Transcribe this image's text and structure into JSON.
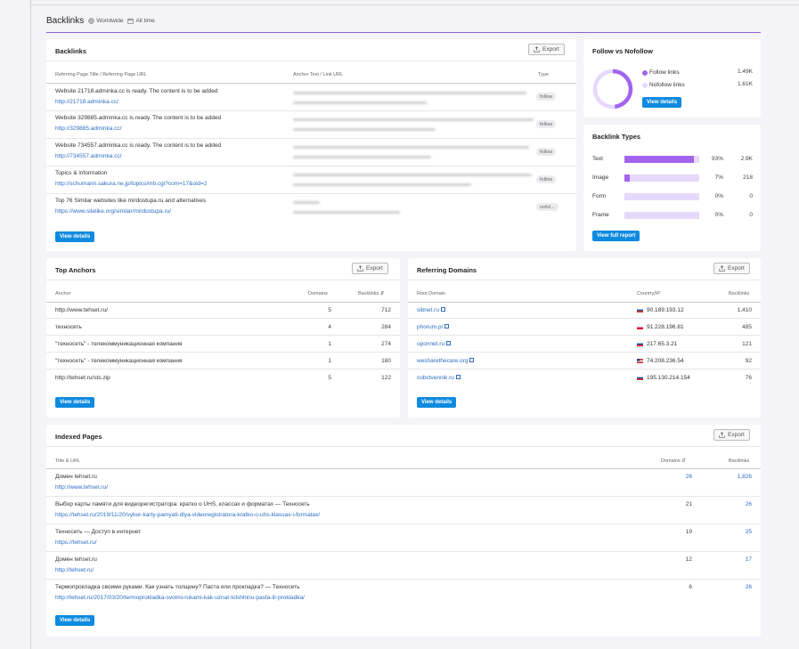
{
  "header": {
    "title": "Backlinks",
    "region": "Worldwide",
    "period": "All time"
  },
  "backlinks": {
    "title": "Backlinks",
    "export_label": "Export",
    "col_ref": "Referring Page Title / Referring Page URL",
    "col_anchor": "Anchor Text / Link URL",
    "col_type": "Type",
    "rows": [
      {
        "title": "Website 21718.adminka.cc is ready. The content is to be added",
        "url": "http://21718.adminka.cc/",
        "type": "follow"
      },
      {
        "title": "Website 329885.adminka.cc is ready. The content is to be added",
        "url": "http://329885.adminka.cc/",
        "type": "follow"
      },
      {
        "title": "Website 734557.adminka.cc is ready. The content is to be added",
        "url": "http://734557.adminka.cc/",
        "type": "follow"
      },
      {
        "title": "Topics & information",
        "url": "http://schumann.sakura.ne.jp/topics/mb.cgi?com=17&oid=2",
        "type": "follow"
      },
      {
        "title": "Top 76 Similar websites like mirdostupa.ru and alternatives",
        "url": "https://www.sitelike.org/similar/mirdostupa.ru/",
        "type": "nofol..."
      }
    ],
    "view_label": "View details"
  },
  "follow": {
    "title": "Follow vs Nofollow",
    "follow_label": "Follow links",
    "follow_value": "1.49K",
    "nofollow_label": "Nofollow links",
    "nofollow_value": "1.61K",
    "view_label": "View details",
    "colors": {
      "follow": "#a264ee",
      "nofollow": "#e6d9fb"
    }
  },
  "types": {
    "title": "Backlink Types",
    "rows": [
      {
        "label": "Text",
        "pct": "93%",
        "count": "2.9K",
        "fill": 0.93
      },
      {
        "label": "Image",
        "pct": "7%",
        "count": "218",
        "fill": 0.07
      },
      {
        "label": "Form",
        "pct": "0%",
        "count": "0",
        "fill": 0
      },
      {
        "label": "Frame",
        "pct": "0%",
        "count": "0",
        "fill": 0
      }
    ],
    "report_label": "View full report"
  },
  "anchors": {
    "title": "Top Anchors",
    "export_label": "Export",
    "col_anchor": "Anchor",
    "col_domains": "Domains",
    "col_backlinks": "Backlinks",
    "rows": [
      {
        "anchor": "http://www.tehset.ru/",
        "domains": "5",
        "backlinks": "712"
      },
      {
        "anchor": "техносеть",
        "domains": "4",
        "backlinks": "284"
      },
      {
        "anchor": "\"техносеть\" - телекоммуникационная компания",
        "domains": "1",
        "backlinks": "274"
      },
      {
        "anchor": "\"техносеть\" - телекоммуникационная компания",
        "domains": "1",
        "backlinks": "180"
      },
      {
        "anchor": "http://tehset.ru/sts.zip",
        "domains": "5",
        "backlinks": "122"
      }
    ],
    "view_label": "View details"
  },
  "domains": {
    "title": "Referring Domains",
    "export_label": "Export",
    "col_root": "Root Domain",
    "col_country": "Country/IP",
    "col_backlinks": "Backlinks",
    "rows": [
      {
        "domain": "sibnet.ru",
        "flag": "ru",
        "ip": "90.189.193.12",
        "backlinks": "1,410"
      },
      {
        "domain": "phorum.pl",
        "flag": "pl",
        "ip": "91.228.196.81",
        "backlinks": "485"
      },
      {
        "domain": "oponnet.ru",
        "flag": "ru",
        "ip": "217.65.3.21",
        "backlinks": "121"
      },
      {
        "domain": "wesharethecare.org",
        "flag": "us",
        "ip": "74.208.236.54",
        "backlinks": "92"
      },
      {
        "domain": "cobctvennik.ru",
        "flag": "ru",
        "ip": "195.130.214.154",
        "backlinks": "76"
      }
    ],
    "view_label": "View details"
  },
  "indexed": {
    "title": "Indexed Pages",
    "export_label": "Export",
    "col_title": "Title & URL",
    "col_domains": "Domains",
    "col_backlinks": "Backlinks",
    "rows": [
      {
        "title": "Домен tehset.ru",
        "url": "http://www.tehset.ru/",
        "domains": "26",
        "backlinks": "1,826"
      },
      {
        "title": "Выбор карты памяти для видеорегистратора: кратко о UHS, классах и форматах — Техносеть",
        "url": "https://tehset.ru/2019/11/20/vybor-karty-pamyati-dlya-videoregistratora-kratko-o-uhs-klassax-i-formatax/",
        "domains": "21",
        "backlinks": "26"
      },
      {
        "title": "Техносеть — Доступ в интернет",
        "url": "https://tehset.ru/",
        "domains": "19",
        "backlinks": "25"
      },
      {
        "title": "Домен tehset.ru",
        "url": "http://tehset.ru/",
        "domains": "12",
        "backlinks": "17"
      },
      {
        "title": "Термопрокладка своими руками. Как узнать толщину? Паста или прокладка? — Техносеть",
        "url": "http://tehset.ru/2017/03/20/termoprokladka-svoimi-rukami-kak-uznat-tolshhinu-pasta-ili-prokladka/",
        "domains": "6",
        "backlinks": "26"
      }
    ],
    "view_label": "View details"
  }
}
